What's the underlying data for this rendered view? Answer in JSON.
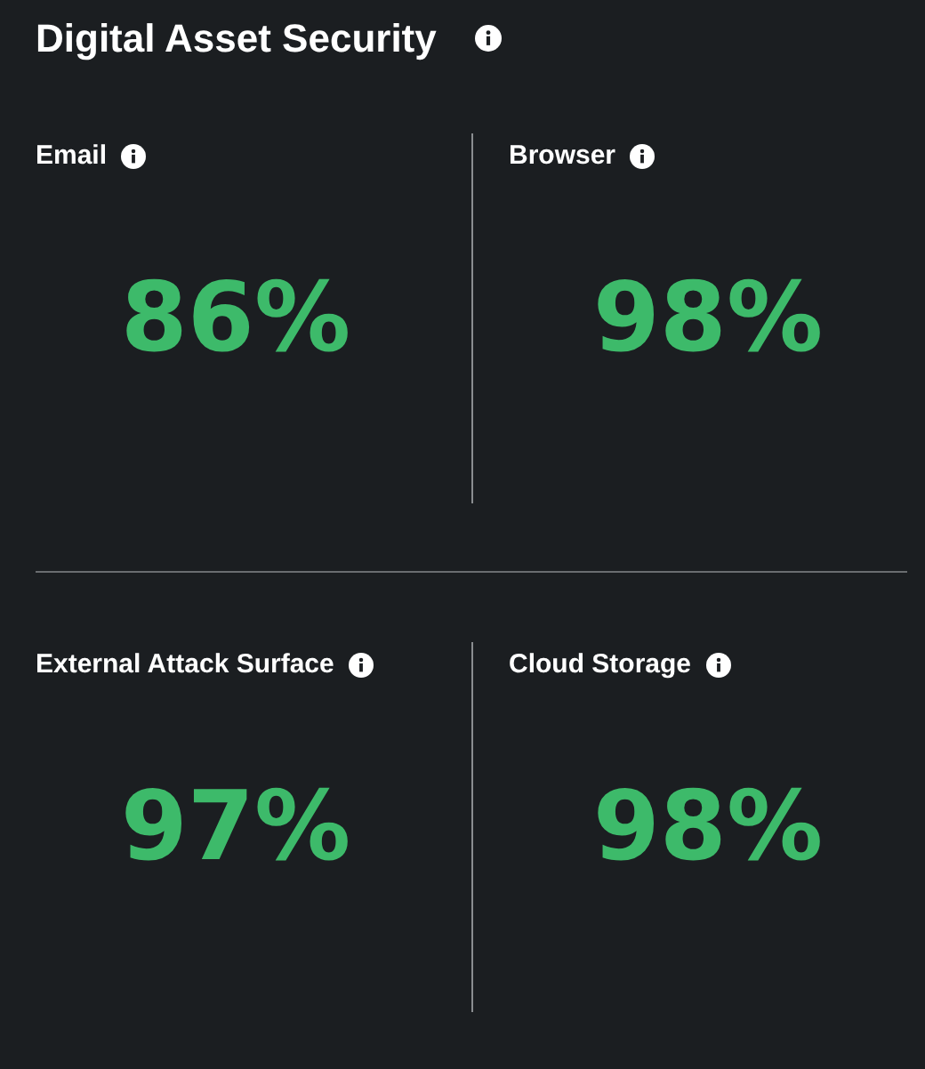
{
  "title": "Digital Asset Security",
  "rows": [
    [
      {
        "label": "Email",
        "value": "86%"
      },
      {
        "label": "Browser",
        "value": "98%"
      }
    ],
    [
      {
        "label": "External Attack Surface",
        "value": "97%"
      },
      {
        "label": "Cloud Storage",
        "value": "98%"
      }
    ]
  ]
}
